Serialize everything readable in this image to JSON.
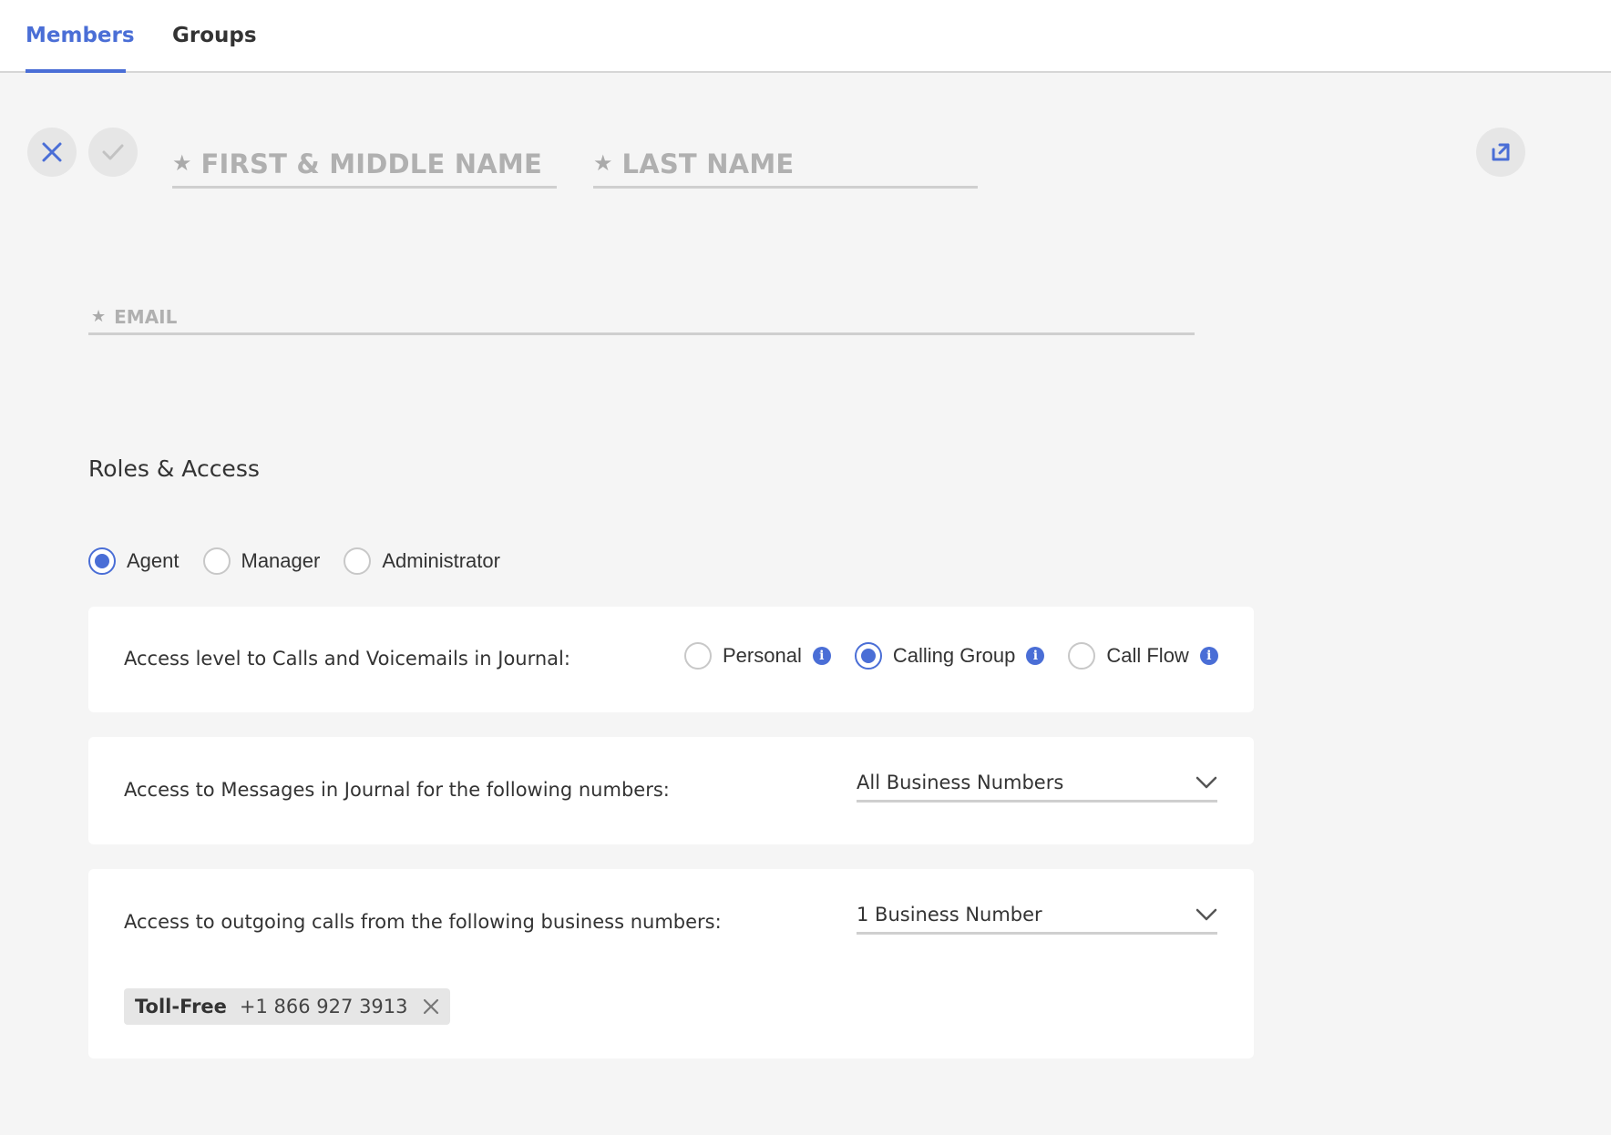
{
  "tabs": [
    {
      "label": "Members",
      "active": true
    },
    {
      "label": "Groups",
      "active": false
    }
  ],
  "form": {
    "first_name_placeholder": "FIRST & MIDDLE NAME",
    "last_name_placeholder": "LAST NAME",
    "email_placeholder": "EMAIL"
  },
  "roles": {
    "title": "Roles & Access",
    "options": [
      {
        "label": "Agent",
        "selected": true
      },
      {
        "label": "Manager",
        "selected": false
      },
      {
        "label": "Administrator",
        "selected": false
      }
    ]
  },
  "journal_access": {
    "label": "Access level to Calls and Voicemails in Journal:",
    "options": [
      {
        "label": "Personal",
        "selected": false
      },
      {
        "label": "Calling Group",
        "selected": true
      },
      {
        "label": "Call Flow",
        "selected": false
      }
    ]
  },
  "messages_access": {
    "label": "Access to Messages in Journal for the following numbers:",
    "value": "All Business Numbers"
  },
  "outgoing_access": {
    "label": "Access to outgoing calls from the following business numbers:",
    "value": "1 Business Number",
    "chips": [
      {
        "type": "Toll-Free",
        "number": "+1 866 927 3913"
      }
    ]
  },
  "colors": {
    "accent": "#4a6ed6",
    "background": "#f5f5f5",
    "card": "#ffffff",
    "placeholder": "#b0b0b0"
  },
  "icons": [
    "close-icon",
    "check-icon",
    "star-icon",
    "expand-icon",
    "info-icon",
    "chevron-down-icon",
    "remove-chip-icon"
  ]
}
